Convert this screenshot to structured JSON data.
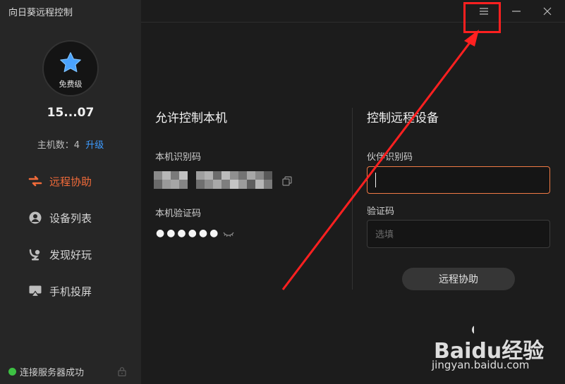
{
  "app": {
    "title": "向日葵远程控制"
  },
  "account": {
    "tier": "免费级",
    "user_id": "15...07",
    "host_count_label": "主机数：4",
    "upgrade_label": "升级"
  },
  "nav": [
    {
      "label": "远程协助",
      "icon": "remote-assist-icon",
      "active": true
    },
    {
      "label": "设备列表",
      "icon": "device-list-icon",
      "active": false
    },
    {
      "label": "发现好玩",
      "icon": "discover-icon",
      "active": false
    },
    {
      "label": "手机投屏",
      "icon": "screen-cast-icon",
      "active": false
    }
  ],
  "status": {
    "text": "连接服务器成功",
    "color": "#3dc143"
  },
  "allow": {
    "title": "允许控制本机",
    "id_label": "本机识别码",
    "code_label": "本机验证码",
    "code_value": "●●●●●●"
  },
  "control": {
    "title": "控制远程设备",
    "partner_label": "伙伴识别码",
    "partner_value": "",
    "code_label": "验证码",
    "code_placeholder": "选填",
    "connect_label": "远程协助"
  },
  "watermark": {
    "brand": "Baidu经验",
    "url": "jingyan.baidu.com"
  },
  "colors": {
    "accent": "#f26b3a",
    "link": "#3d9bff",
    "annotation": "#ff2020"
  }
}
